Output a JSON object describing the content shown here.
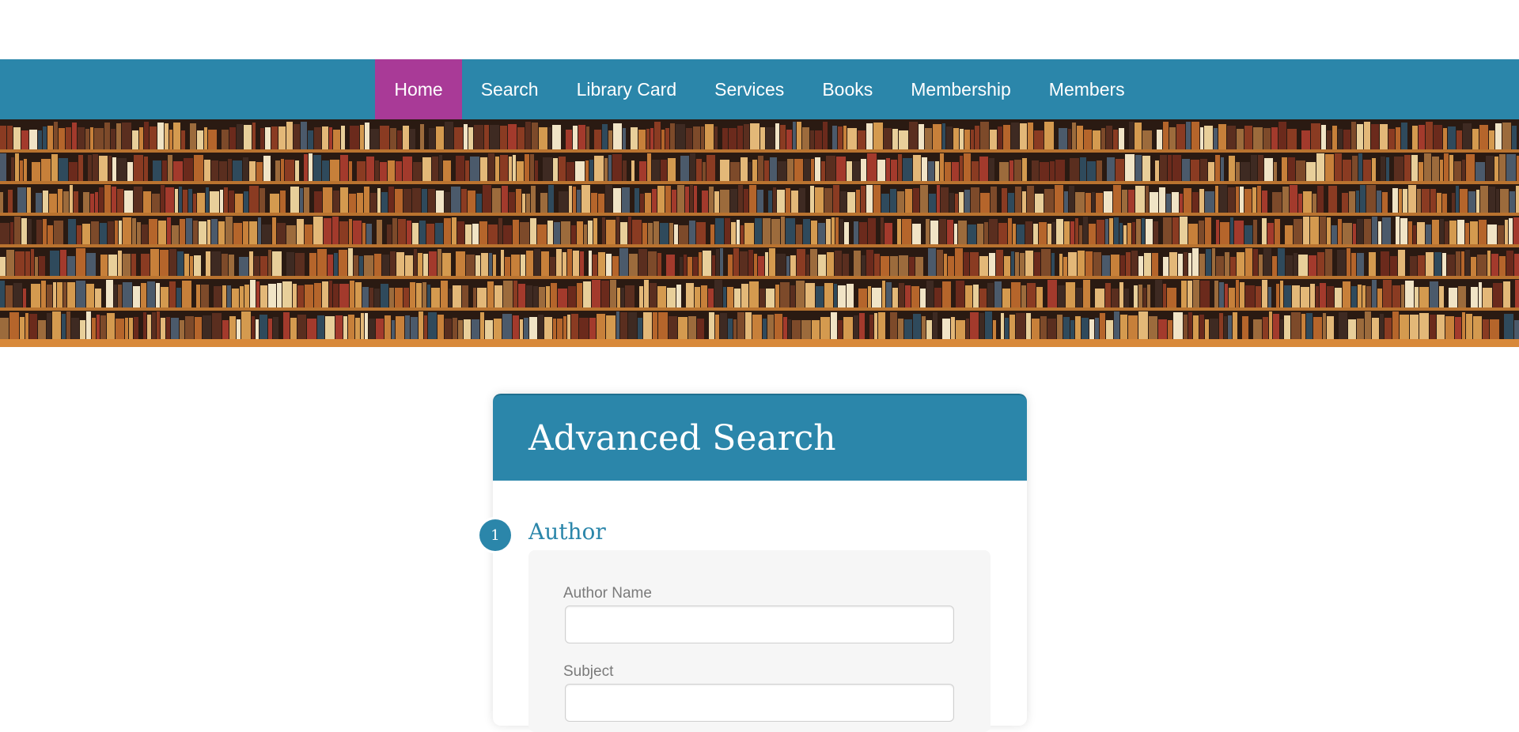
{
  "nav": {
    "items": [
      {
        "label": "Home",
        "active": true
      },
      {
        "label": "Search"
      },
      {
        "label": "Library Card"
      },
      {
        "label": "Services"
      },
      {
        "label": "Books"
      },
      {
        "label": "Membership"
      },
      {
        "label": "Members"
      }
    ]
  },
  "colors": {
    "nav_bg": "#2b86aa",
    "nav_active": "#a93a97",
    "accent": "#2b86aa"
  },
  "card": {
    "title": "Advanced Search",
    "sections": [
      {
        "step": "1",
        "title": "Author",
        "fields": [
          {
            "label": "Author Name",
            "value": ""
          },
          {
            "label": "Subject",
            "value": ""
          }
        ]
      }
    ]
  }
}
